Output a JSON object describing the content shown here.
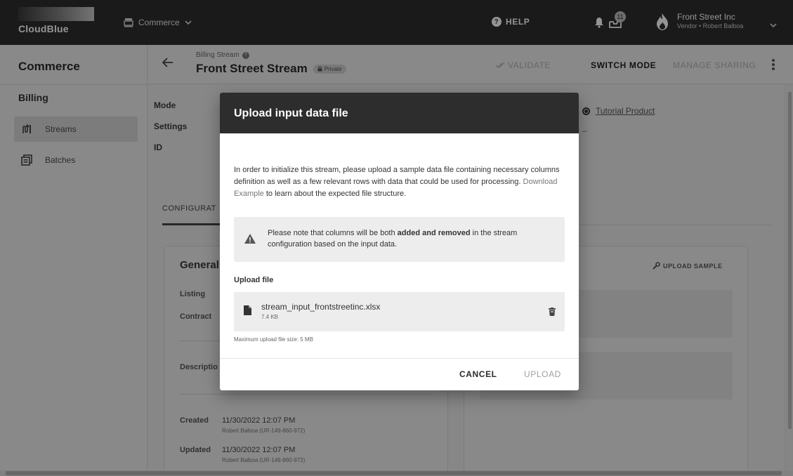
{
  "app": {
    "logo_text": "CloudBlue",
    "module": "Commerce",
    "help_label": "HELP",
    "notifications_count": "11",
    "account_name": "Front Street Inc",
    "account_role": "Vendor • Robert Balboa"
  },
  "sidebar": {
    "title": "Commerce",
    "section": "Billing",
    "items": [
      {
        "label": "Streams",
        "active": true
      },
      {
        "label": "Batches",
        "active": false
      }
    ]
  },
  "header": {
    "breadcrumb": "Billing Stream",
    "title": "Front Street Stream",
    "chip": "Private",
    "validate": "VALIDATE",
    "switch_mode": "SWITCH MODE",
    "manage_sharing": "MANAGE SHARING"
  },
  "details": {
    "mode_label": "Mode",
    "settings_label": "Settings",
    "id_label": "ID",
    "product": "Tutorial Product",
    "product_dash": "–",
    "tab": "CONFIGURAT",
    "general_title": "General",
    "listing_label": "Listing",
    "contract_label": "Contract",
    "description_label": "Descriptio",
    "created_label": "Created",
    "created_value": "11/30/2022 12:07 PM",
    "created_by": "Robert Balboa (UR-149-860-972)",
    "updated_label": "Updated",
    "updated_value": "11/30/2022 12:07 PM",
    "updated_by": "Robert Balboa (UR-149-860-972)",
    "upload_sample": "UPLOAD SAMPLE"
  },
  "dialog": {
    "title": "Upload input data file",
    "intro_before": "In order to initialize this stream, please upload a sample data file containing necessary columns definition as well as a few relevant rows with data that could be used for processing. ",
    "intro_link": "Download Example",
    "intro_after": " to learn about the expected file structure.",
    "note_before": "Please note that columns will be both ",
    "note_bold": "added and removed",
    "note_after": " in the stream configuration based on the input data.",
    "upload_label": "Upload file",
    "file_name": "stream_input_frontstreetinc.xlsx",
    "file_size": "7.4 KB",
    "max_size": "Maximum upload file size: 5 MB",
    "cancel": "CANCEL",
    "upload": "UPLOAD"
  }
}
